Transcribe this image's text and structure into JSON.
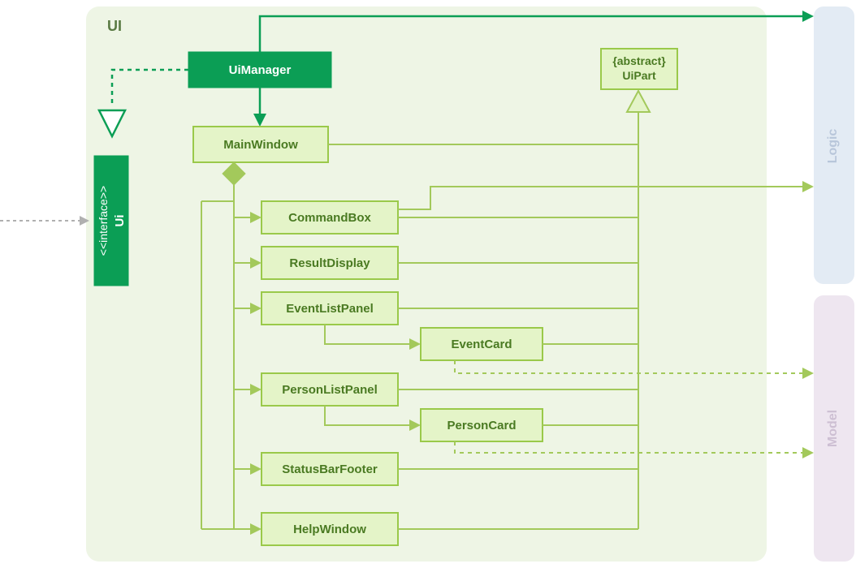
{
  "package": {
    "name": "UI"
  },
  "interface": {
    "stereotype": "<<interface>>",
    "name": "Ui"
  },
  "abstract": {
    "tag": "{abstract}",
    "name": "UiPart"
  },
  "classes": {
    "uiManager": "UiManager",
    "mainWindow": "MainWindow",
    "commandBox": "CommandBox",
    "resultDisplay": "ResultDisplay",
    "eventListPanel": "EventListPanel",
    "eventCard": "EventCard",
    "personListPanel": "PersonListPanel",
    "personCard": "PersonCard",
    "statusBarFooter": "StatusBarFooter",
    "helpWindow": "HelpWindow"
  },
  "external": {
    "logic": "Logic",
    "model": "Model"
  }
}
